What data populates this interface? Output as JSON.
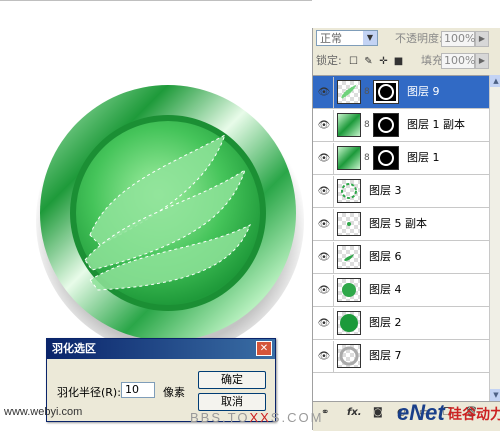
{
  "layers_panel": {
    "blend_mode": "正常",
    "opacity_label": "不透明度:",
    "opacity_value": "100%",
    "lock_label": "锁定:",
    "fill_label": "填充:",
    "fill_value": "100%",
    "layers": [
      {
        "name": "图层 9",
        "active": true,
        "thumb": "leaf",
        "mask": true
      },
      {
        "name": "图层 1 副本",
        "active": false,
        "thumb": "green-gradient",
        "mask": true
      },
      {
        "name": "图层 1",
        "active": false,
        "thumb": "green-gradient",
        "mask": true
      },
      {
        "name": "图层 3",
        "active": false,
        "thumb": "dashed-ring",
        "mask": false
      },
      {
        "name": "图层 5 副本",
        "active": false,
        "thumb": "dot",
        "mask": false
      },
      {
        "name": "图层 6",
        "active": false,
        "thumb": "small-shape",
        "mask": false
      },
      {
        "name": "图层 4",
        "active": false,
        "thumb": "green-circle",
        "mask": false
      },
      {
        "name": "图层 2",
        "active": false,
        "thumb": "green-circle-large",
        "mask": false
      },
      {
        "name": "图层 7",
        "active": false,
        "thumb": "ring",
        "mask": false
      }
    ],
    "bottom_icons": [
      "link-icon",
      "fx-icon",
      "mask-icon",
      "adjustment-icon",
      "folder-icon",
      "new-layer-icon",
      "trash-icon"
    ],
    "fx_label": "fx."
  },
  "dialog": {
    "title": "羽化选区",
    "feather_label": "羽化半径(R):",
    "feather_value": "10",
    "unit": "像素",
    "ok_label": "确定",
    "cancel_label": "取消"
  },
  "watermarks": {
    "webyi": "www.webyi.com",
    "bbs_prefix": "BBS.TO",
    "bbs_red": "XX",
    "bbs_suffix": "S.COM",
    "enet": "eNet",
    "enet_cn": "硅谷动力"
  },
  "colors": {
    "accent_active": "#316ac5",
    "emblem_green": "#2fa84a"
  }
}
